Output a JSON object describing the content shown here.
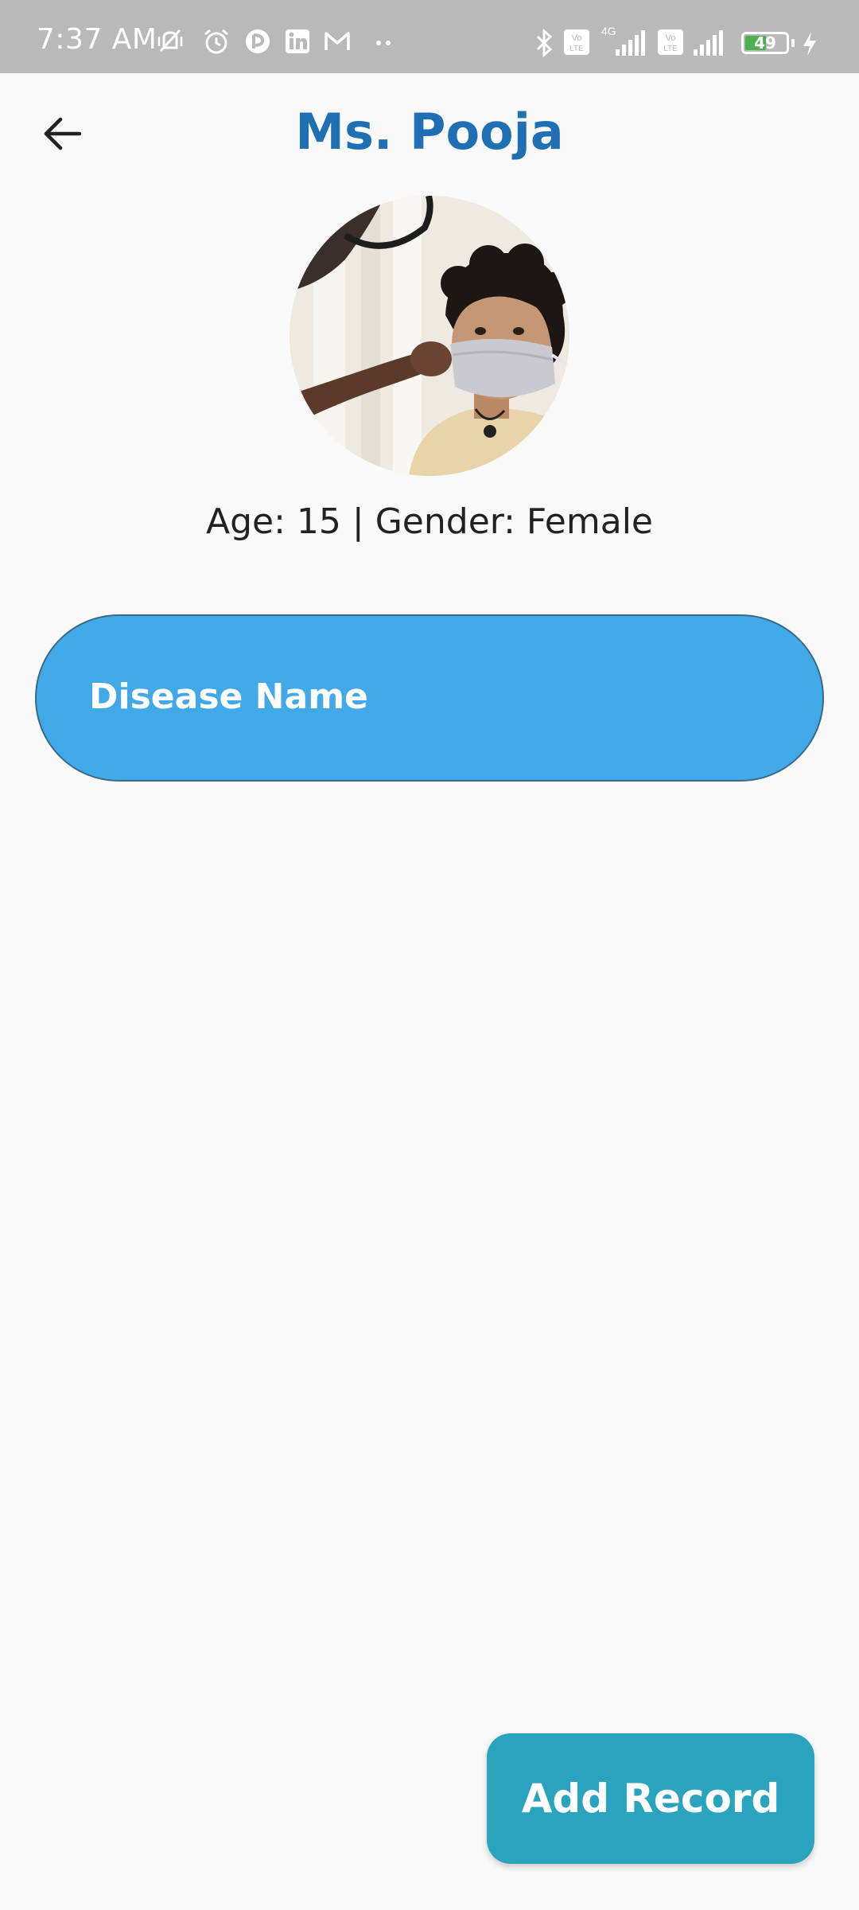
{
  "status_bar": {
    "time": "7:37 AM",
    "battery_level": "49",
    "icons": [
      "vibrate-off-icon",
      "alarm-icon",
      "app-icon",
      "linkedin-icon",
      "gmail-icon",
      "more-dots-icon",
      "bluetooth-icon",
      "volte-icon",
      "signal-icon",
      "volte-icon",
      "signal-icon",
      "battery-icon",
      "charging-icon"
    ],
    "network_label_1": "4G",
    "volte_label": "Vo LTE"
  },
  "header": {
    "title": "Ms. Pooja",
    "back_icon": "arrow-left-icon"
  },
  "patient": {
    "info": "Age: 15 | Gender: Female",
    "avatar": "patient-photo"
  },
  "disease_card": {
    "label": "Disease Name"
  },
  "actions": {
    "add_record_label": "Add Record"
  },
  "colors": {
    "title": "#1e6fb3",
    "card": "#42a9e8",
    "button": "#2aa3bf",
    "background": "#f9f9f9",
    "status_bar": "#b9b9b9",
    "battery_fill": "#4caf50"
  }
}
